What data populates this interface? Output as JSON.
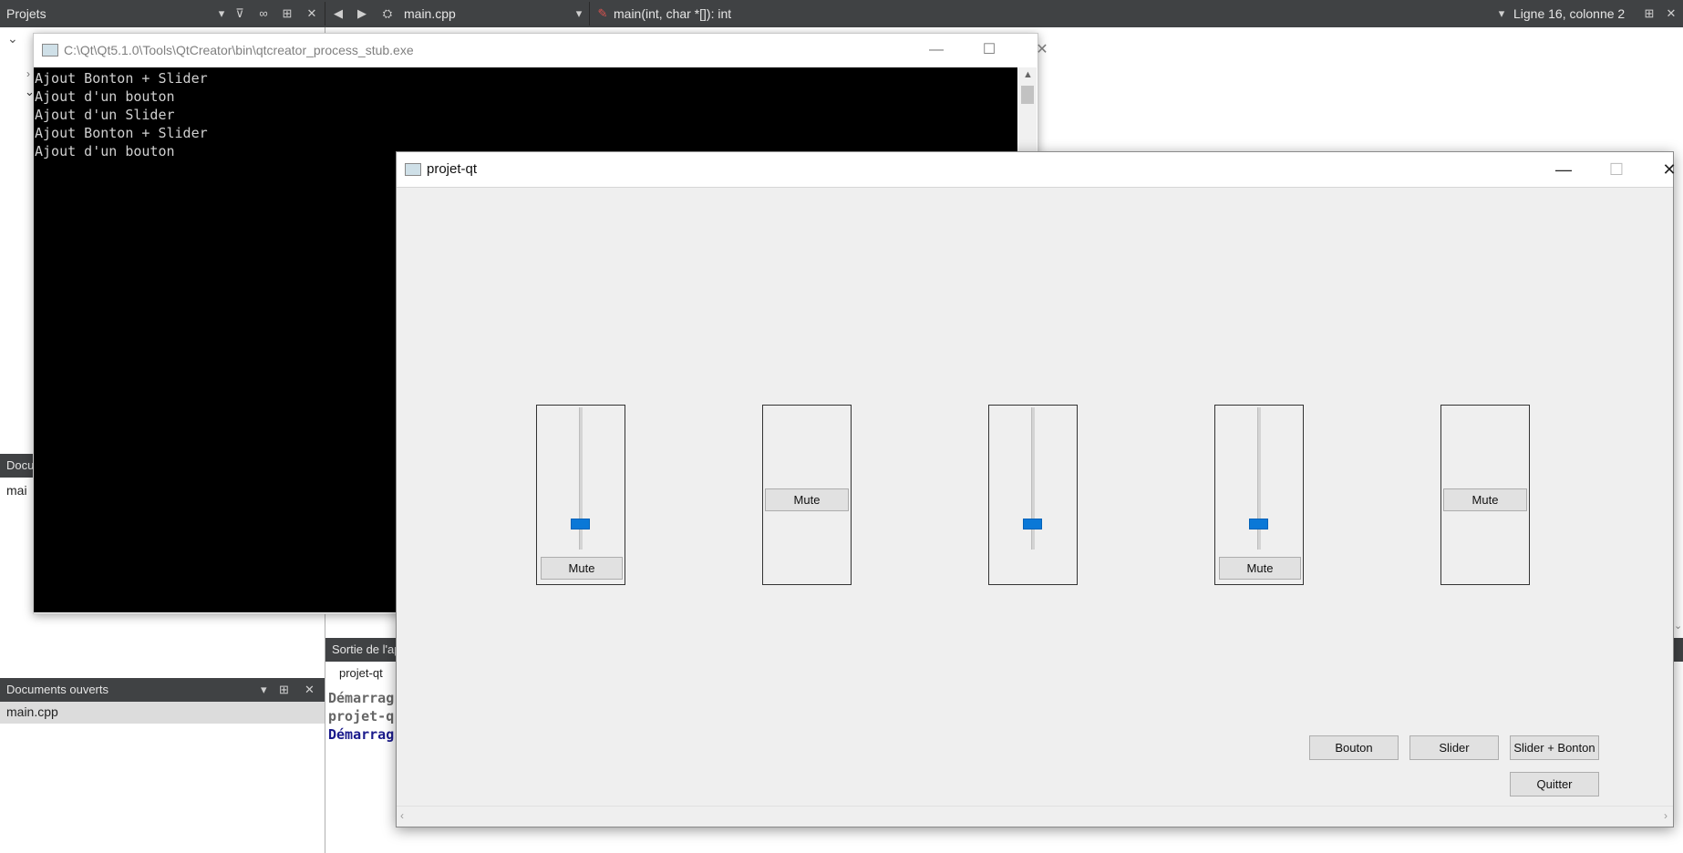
{
  "topbar": {
    "projects_label": "Projets",
    "file_name": "main.cpp",
    "symbol": "main(int, char *[]): int",
    "cursor_position": "Ligne 16, colonne 2"
  },
  "left": {
    "doc_panel_fragment": "Docu",
    "doc_item_fragment": "mai",
    "open_docs_title": "Documents ouverts",
    "open_docs_item": "main.cpp"
  },
  "output": {
    "title_fragment": "Sortie de l'ap",
    "tab_label": "projet-qt",
    "lines": [
      "Démarrag",
      "projet-q",
      "Démarrag"
    ]
  },
  "console": {
    "title": "C:\\Qt\\Qt5.1.0\\Tools\\QtCreator\\bin\\qtcreator_process_stub.exe",
    "lines": [
      "Ajout Bonton + Slider",
      "Ajout d'un bouton",
      "Ajout d'un Slider",
      "Ajout Bonton + Slider",
      "Ajout d'un bouton"
    ]
  },
  "app": {
    "title": "projet-qt",
    "widgets": [
      {
        "slider_value": 0.15,
        "mute_label": "Mute"
      },
      {
        "mute_label": "Mute"
      },
      {
        "slider_value": 0.15
      },
      {
        "slider_value": 0.15,
        "mute_label": "Mute"
      },
      {
        "mute_label": "Mute"
      }
    ],
    "buttons": {
      "bouton": "Bouton",
      "slider": "Slider",
      "slider_bonton": "Slider + Bonton",
      "quitter": "Quitter"
    }
  },
  "colors": {
    "slider_handle": "#0a78d7",
    "dark_bar": "#404244",
    "window_bg": "#efefef"
  }
}
